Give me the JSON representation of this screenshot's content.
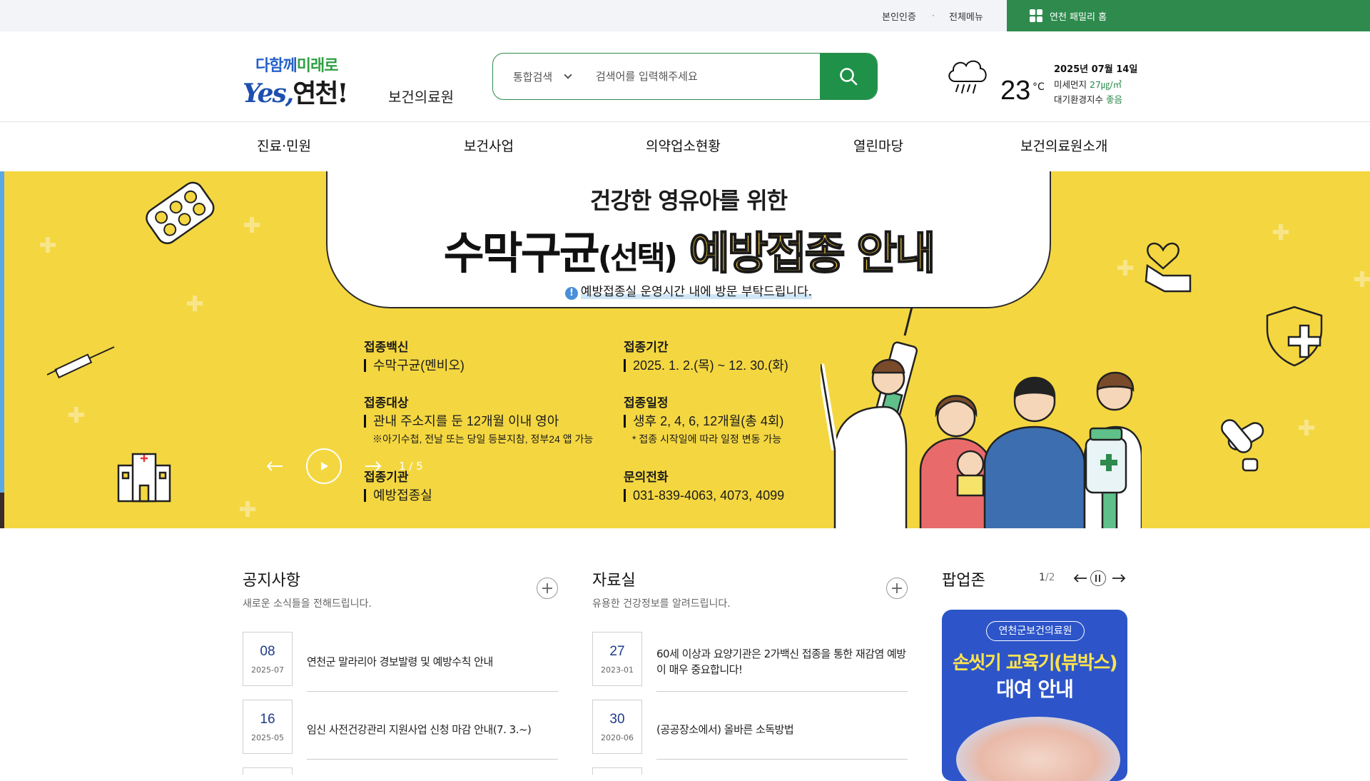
{
  "topbar": {
    "cert": "본인인증",
    "sep": "·",
    "all_menu": "전체메뉴",
    "family": "연천 패밀리 홈"
  },
  "logo": {
    "slogan_a": "다함께",
    "slogan_b": "미래로",
    "brand_a": "Yes,",
    "brand_b": "연천!",
    "org": "보건의료원"
  },
  "search": {
    "scope": "통합검색",
    "placeholder": "검색어를 입력해주세요"
  },
  "weather": {
    "icon": "rain-cloud-icon",
    "temp": "23",
    "unit": "°C",
    "date": "2025년 07월 14일",
    "dust_label": "미세먼지",
    "dust_value": "27㎍/㎥",
    "air_label": "대기환경지수",
    "air_value": "좋음"
  },
  "gnb": [
    "진료·민원",
    "보건사업",
    "의약업소현황",
    "열린마당",
    "보건의료원소개"
  ],
  "banner": {
    "subtitle": "건강한 영유아를 위한",
    "title_a": "수막구균",
    "title_paren": "(선택)",
    "title_b": "예방접종 안내",
    "note": "예방접종실 운영시간 내에 방문 부탁드립니다.",
    "vaccine_label": "접종백신",
    "vaccine_value": "수막구균(멘비오)",
    "target_label": "접종대상",
    "target_value": "관내 주소지를 둔 12개월 이내 영아",
    "target_note": "※아기수첩, 전날 또는 당일 등본지참, 정부24 앱 가능",
    "place_label": "접종기관",
    "place_value": "예방접종실",
    "period_label": "접종기간",
    "period_value": "2025. 1. 2.(목) ~ 12. 30.(화)",
    "schedule_label": "접종일정",
    "schedule_value": "생후 2, 4, 6, 12개월(총 4회)",
    "schedule_note": "* 접종 시작일에 따라 일정 변동 가능",
    "phone_label": "문의전화",
    "phone_value": "031-839-4063, 4073, 4099",
    "counter": "1 / 5",
    "colors": {
      "background": "#f4d740",
      "accent": "#f6c83a"
    }
  },
  "notice": {
    "title": "공지사항",
    "desc": "새로운 소식들을 전해드립니다.",
    "posts": [
      {
        "day": "08",
        "ym": "2025-07",
        "title": "연천군 말라리아 경보발령 및 예방수칙 안내"
      },
      {
        "day": "16",
        "ym": "2025-05",
        "title": "임신 사전건강관리 지원사업 신청 마감 안내(7. 3.~)"
      }
    ]
  },
  "archive": {
    "title": "자료실",
    "desc": "유용한 건강정보를 알려드립니다.",
    "posts": [
      {
        "day": "27",
        "ym": "2023-01",
        "title": "60세 이상과 요양기관은 2가백신 접종을 통한 재감염 예방이 매우 중요합니다!"
      },
      {
        "day": "30",
        "ym": "2020-06",
        "title": "(공공장소에서) 올바른 소독방법"
      }
    ]
  },
  "popup": {
    "title": "팝업존",
    "current": "1",
    "total": "/2",
    "card_pill": "연천군보건의료원",
    "card_line1": "손씻기 교육기(뷰박스)",
    "card_line2": "대여 안내"
  },
  "colors": {
    "brand_green": "#2e8b4d",
    "search_green": "#1f9149",
    "date_blue": "#1e3a8a"
  }
}
